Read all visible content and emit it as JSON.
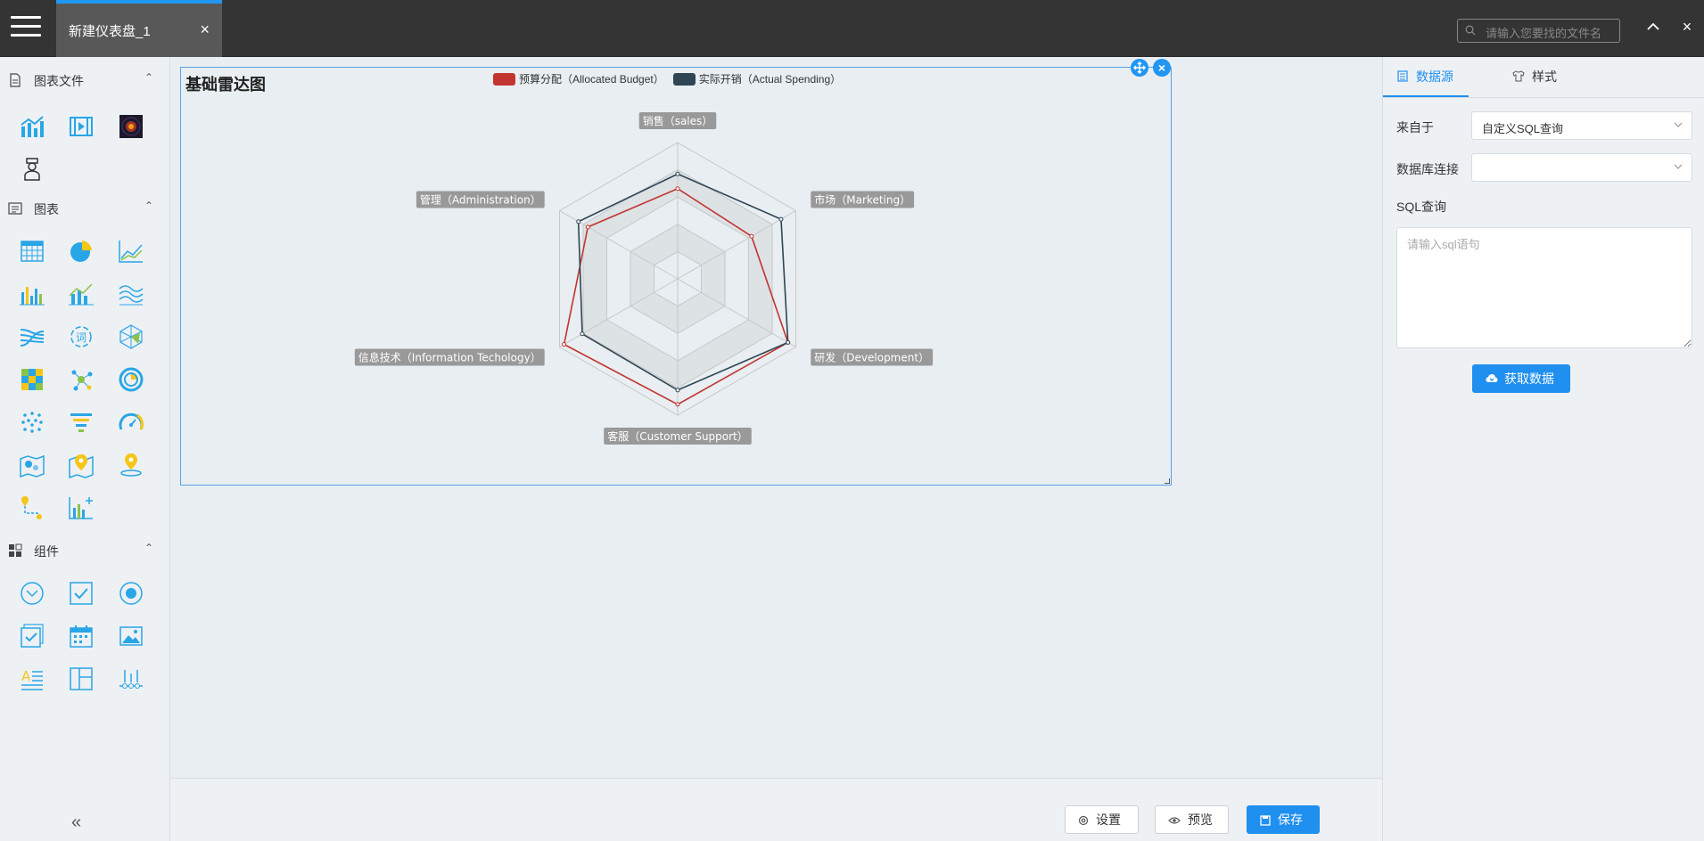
{
  "topbar": {
    "tab_label": "新建仪表盘_1",
    "tab_close": "×",
    "search_placeholder": "请输入您要找的文件名",
    "close_label": "×"
  },
  "sidebar": {
    "sections": [
      {
        "title": "图表文件"
      },
      {
        "title": "图表"
      },
      {
        "title": "组件"
      }
    ],
    "collapse_label": "«"
  },
  "widget": {
    "title": "基础雷达图",
    "close_label": "×"
  },
  "chart_data": {
    "type": "radar",
    "title": "基础雷达图",
    "indicators": [
      "销售（sales）",
      "市场（Marketing）",
      "研发（Development）",
      "客服（Customer Support）",
      "信息技术（Information Techology）",
      "管理（Administration）"
    ],
    "max": [
      6500,
      16000,
      30000,
      38000,
      52000,
      25000
    ],
    "series": [
      {
        "name": "预算分配（Allocated Budget）",
        "color": "#c23531",
        "values": [
          4300,
          10000,
          28000,
          35000,
          50000,
          19000
        ]
      },
      {
        "name": "实际开销（Actual Spending）",
        "color": "#2f4554",
        "values": [
          5000,
          14000,
          28000,
          31000,
          42000,
          21000
        ]
      }
    ],
    "split_number": 5,
    "legend_position": "top"
  },
  "bottom": {
    "settings_label": "设置",
    "preview_label": "预览",
    "save_label": "保存"
  },
  "rpanel": {
    "tab_datasource": "数据源",
    "tab_style": "样式",
    "source_label": "来自于",
    "source_value": "自定义SQL查询",
    "db_label": "数据库连接",
    "db_value": "",
    "sql_label": "SQL查询",
    "sql_placeholder": "请输入sql语句",
    "fetch_label": "获取数据"
  },
  "colors": {
    "accent": "#1f8ff0",
    "topbar": "#343434",
    "tab_active": "#585858"
  }
}
